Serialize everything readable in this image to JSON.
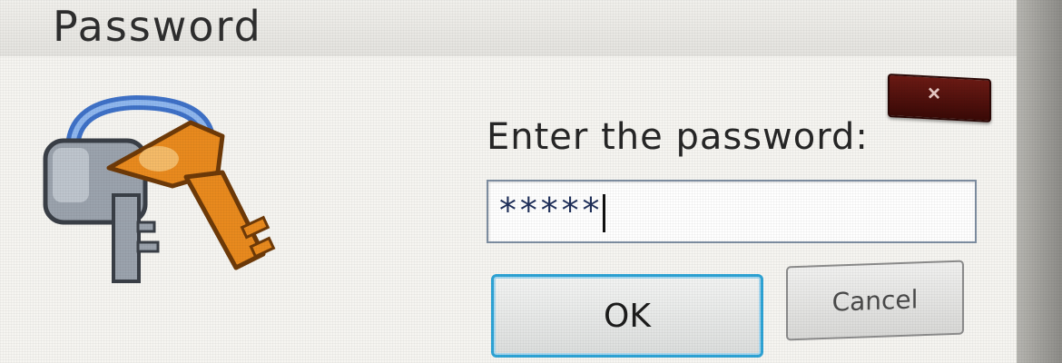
{
  "window": {
    "title": "Password"
  },
  "dialog": {
    "prompt": "Enter the password:",
    "password_value": "*****",
    "ok_label": "OK",
    "cancel_label": "Cancel",
    "close_glyph": "×"
  },
  "icons": {
    "dialog_icon": "padlock-and-key-icon",
    "close": "close-icon"
  },
  "colors": {
    "focus_border": "#2ea4d6",
    "close_button": "#6b1a14",
    "key_orange": "#e98a1e",
    "lock_gray": "#9ba3ad"
  }
}
